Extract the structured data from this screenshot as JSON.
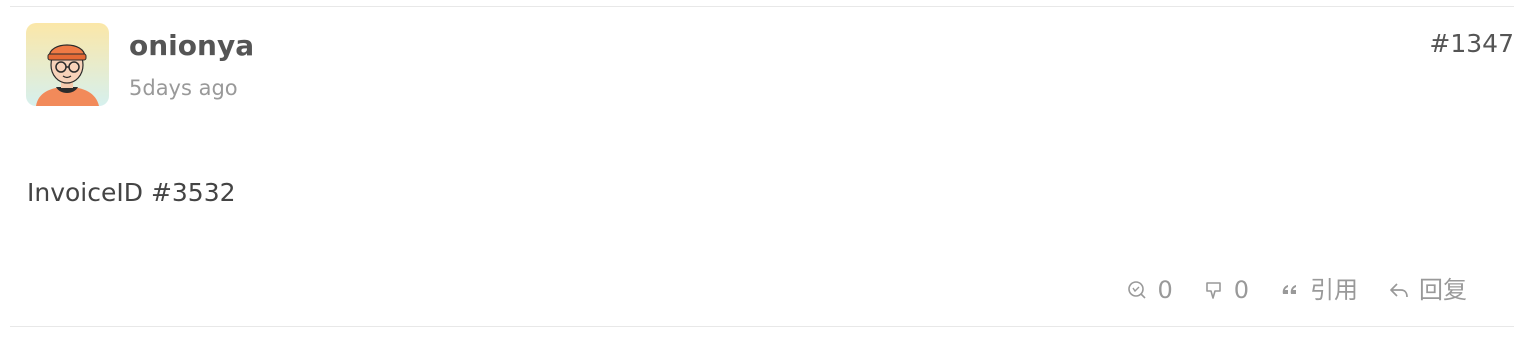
{
  "post": {
    "username": "onionya",
    "timestamp": "5days ago",
    "number": "#1347",
    "content": "InvoiceID #3532"
  },
  "actions": {
    "like_count": "0",
    "dislike_count": "0",
    "quote_label": "引用",
    "reply_label": "回复"
  },
  "icons": {
    "avatar": "avatar-illustration",
    "like": "like-icon",
    "dislike": "dislike-icon",
    "quote": "quote-icon",
    "reply": "reply-icon"
  },
  "colors": {
    "username": "#555555",
    "meta": "#999999",
    "divider": "#e8e8e8"
  }
}
